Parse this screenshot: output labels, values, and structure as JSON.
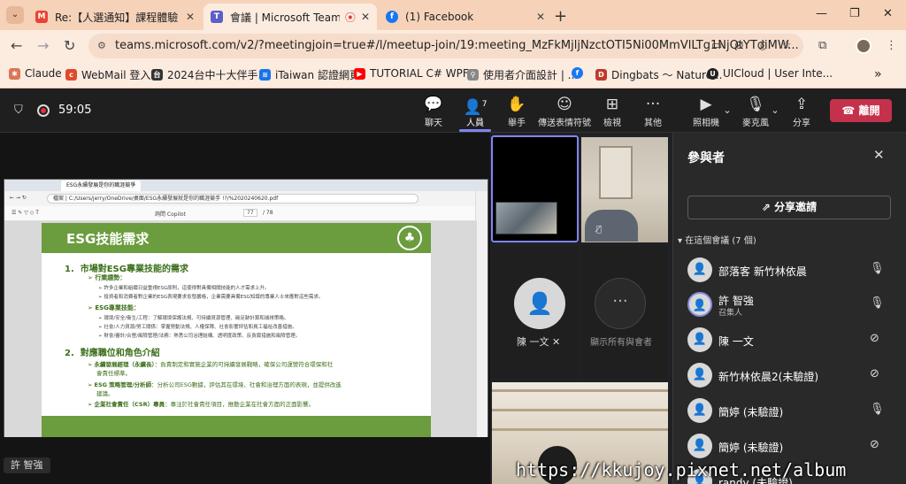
{
  "browser": {
    "tabs": [
      {
        "title": "Re:【人選通知】課程體驗「ESG",
        "icon": "gmail-icon",
        "color": "#ea4335"
      },
      {
        "title": "會議 | Microsoft Teams",
        "icon": "teams-icon",
        "color": "#5b5fc7"
      },
      {
        "title": "(1) Facebook",
        "icon": "facebook-icon",
        "color": "#1877f2"
      }
    ],
    "url": "teams.microsoft.com/v2/?meetingjoin=true#/l/meetup-join/19:meeting_MzFkMjljNzctOTI5Ni00MmVlLTg1NjQtYTdiMW...",
    "bookmarks": [
      {
        "label": "Claude",
        "color": "#d97757"
      },
      {
        "label": "WebMail 登入",
        "color": "#e04a2b"
      },
      {
        "label": "2024台中十大伴手...",
        "color": "#333333"
      },
      {
        "label": "iTaiwan 認證網頁",
        "color": "#1a73e8"
      },
      {
        "label": "TUTORIAL C# WPF...",
        "color": "#ff0000"
      },
      {
        "label": "使用者介面設計 | ...",
        "color": "#888888"
      },
      {
        "label": "",
        "color": "#1877f2"
      },
      {
        "label": "Dingbats ～ Nature...",
        "color": "#c0392b"
      },
      {
        "label": "UICloud | User Inte...",
        "color": "#222222"
      }
    ]
  },
  "teams": {
    "timer": "59:05",
    "toolbar": [
      {
        "label": "聊天",
        "icon": "chat-icon"
      },
      {
        "label": "人員",
        "icon": "people-icon",
        "count": "7"
      },
      {
        "label": "舉手",
        "icon": "raise-hand-icon"
      },
      {
        "label": "傳送表情符號",
        "icon": "emoji-icon"
      },
      {
        "label": "檢視",
        "icon": "view-icon"
      },
      {
        "label": "其他",
        "icon": "more-icon"
      },
      {
        "label": "照相機",
        "icon": "camera-icon"
      },
      {
        "label": "麥克風",
        "icon": "microphone-icon"
      },
      {
        "label": "分享",
        "icon": "share-icon"
      }
    ],
    "leave_label": "離開",
    "presenter_label": "許 智強",
    "tiles": {
      "person1": "陳 一文",
      "show_all": "顯示所有與會者"
    }
  },
  "shared_screen": {
    "tab_title": "ESG永續發展是你的職涯競爭",
    "file_label": "檔案",
    "path": "C:/Users/jerry/OneDrive/桌面/ESG永續發展就是你的職涯競手 !?/%2020240620.pdf",
    "toolbar_text": "詢問 Copilot",
    "page_current": "77",
    "page_total": "/ 78",
    "slide": {
      "title": "ESG技能需求",
      "section1": "1.  市場對ESG專業技能的需求",
      "s1_items": [
        {
          "head": "行業趨勢：",
          "lines": [
            "許多企業和組織日益重視ESG原則，這使得對具備相關技能的人才需求上升。",
            "投資者和消費者對企業的ESG表現要求愈發嚴格，企業需要具備ESG知識的專業人士來應對這些需求。"
          ]
        },
        {
          "head": "ESG專業技能：",
          "lines": [
            "環境/安全/衛生/工程：了解環境保護法規、可持續資源管理、碳足跡計算和減排策略。",
            "社會/人力資源/勞工關係：掌握勞動法規、人權保障、社會影響評估和員工福祉改善措施。",
            "財會/審計/合營/風險管理/法務：熟悉公司治理結構、透明度政策、反貪腐措施和風險管理。"
          ]
        }
      ],
      "section2": "2.  對應職位和角色介紹",
      "s2_items": [
        {
          "head": "永續發展經理（永續長）",
          "text": "：負責制定和實施企業的可持續發展戰略，確保公司運營符合環保和社",
          "cont": "會責任標準。"
        },
        {
          "head": "ESG 策略管理/分析師",
          "text": "：分析公司ESG數據，評估其在環境、社會和治理方面的表現，並提供改進",
          "cont": "建議。"
        },
        {
          "head": "企業社會責任（CSR）專員",
          "text": "：專注於社會責任項目，推動企業在社會方面的正面影響。",
          "cont": ""
        }
      ]
    }
  },
  "panel": {
    "title": "參與者",
    "share_invite": "分享邀請",
    "section": "在這個會議 (7 個)",
    "participants": [
      {
        "name": "部落客 新竹林依晨",
        "role": "",
        "mic": "on"
      },
      {
        "name": "許 智強",
        "role": "召集人",
        "mic": "on"
      },
      {
        "name": "陳 一文",
        "role": "",
        "mic": "muted"
      },
      {
        "name": "新竹林依晨2(未驗證)",
        "role": "",
        "mic": "muted"
      },
      {
        "name": "簡婷 (未驗證)",
        "role": "",
        "mic": "on"
      },
      {
        "name": "簡婷 (未驗證)",
        "role": "",
        "mic": "muted"
      },
      {
        "name": "randy (未驗證)",
        "role": "",
        "mic": "on"
      }
    ]
  },
  "watermark": "https://kkujoy.pixnet.net/album"
}
